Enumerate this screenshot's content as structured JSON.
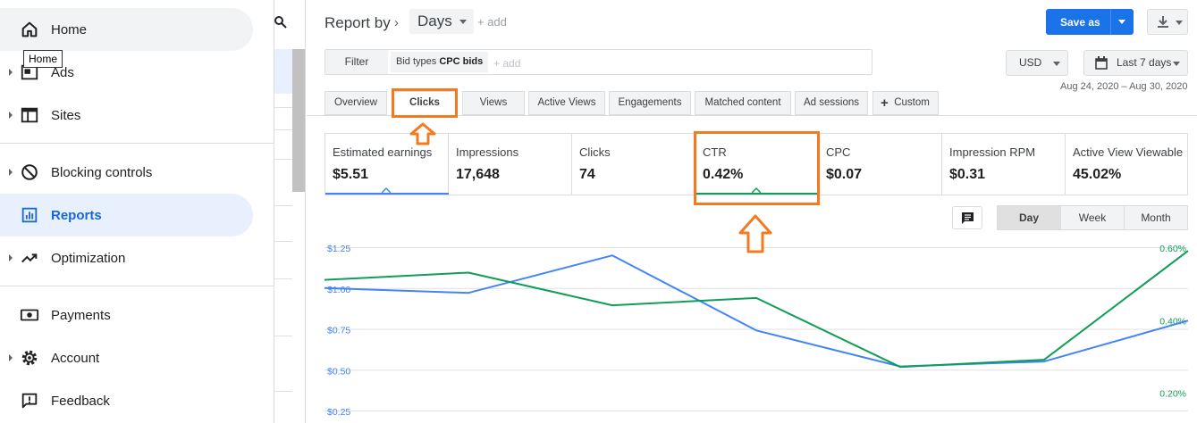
{
  "sidebar": {
    "items": [
      {
        "label": "Home",
        "icon": "home-icon"
      },
      {
        "label": "Ads",
        "icon": "ads-icon"
      },
      {
        "label": "Sites",
        "icon": "sites-icon"
      },
      {
        "label": "Blocking controls",
        "icon": "block-icon"
      },
      {
        "label": "Reports",
        "icon": "reports-icon"
      },
      {
        "label": "Optimization",
        "icon": "trending-icon"
      },
      {
        "label": "Payments",
        "icon": "payments-icon"
      },
      {
        "label": "Account",
        "icon": "gear-icon"
      },
      {
        "label": "Feedback",
        "icon": "feedback-icon"
      }
    ],
    "tooltip": "Home",
    "active_color": "#1a73e8"
  },
  "header": {
    "report_by": "Report by",
    "days": "Days",
    "add": "+ add",
    "save_as": "Save as"
  },
  "filterbar": {
    "filter": "Filter",
    "chip_prefix": "Bid types",
    "chip_value": "CPC bids",
    "add": "+ add"
  },
  "currency": "USD",
  "date": {
    "label": "Last 7 days",
    "range": "Aug 24, 2020 – Aug 30, 2020"
  },
  "tabs": [
    {
      "label": "Overview"
    },
    {
      "label": "Clicks"
    },
    {
      "label": "Views"
    },
    {
      "label": "Active Views"
    },
    {
      "label": "Engagements"
    },
    {
      "label": "Matched content"
    },
    {
      "label": "Ad sessions"
    },
    {
      "label": "Custom"
    }
  ],
  "metrics": [
    {
      "name": "Estimated earnings",
      "value": "$5.51"
    },
    {
      "name": "Impressions",
      "value": "17,648"
    },
    {
      "name": "Clicks",
      "value": "74"
    },
    {
      "name": "CTR",
      "value": "0.42%"
    },
    {
      "name": "CPC",
      "value": "$0.07"
    },
    {
      "name": "Impression RPM",
      "value": "$0.31"
    },
    {
      "name": "Active View Viewable",
      "value": "45.02%"
    }
  ],
  "granularity": [
    {
      "label": "Day"
    },
    {
      "label": "Week"
    },
    {
      "label": "Month"
    }
  ],
  "colors": {
    "earnings": "#4285f4",
    "ctr": "#0f9d58",
    "annotation": "#f47a20"
  },
  "chart_data": {
    "type": "line",
    "x": [
      1,
      2,
      3,
      4,
      5,
      6,
      7
    ],
    "left_axis": {
      "ticks": [
        "$1.25",
        "$1.00",
        "$0.75",
        "$0.50",
        "$0.25"
      ],
      "ylim": [
        0.25,
        1.25
      ]
    },
    "right_axis": {
      "ticks": [
        "0.60%",
        "0.40%",
        "0.20%"
      ],
      "ylim": [
        0.15,
        0.6
      ]
    },
    "series": [
      {
        "axis": "left",
        "values": [
          1.0,
          0.97,
          1.2,
          0.74,
          0.52,
          0.55,
          0.8
        ]
      },
      {
        "axis": "right",
        "values": [
          0.51,
          0.53,
          0.44,
          0.46,
          0.27,
          0.29,
          0.59
        ]
      }
    ],
    "grid": true
  }
}
